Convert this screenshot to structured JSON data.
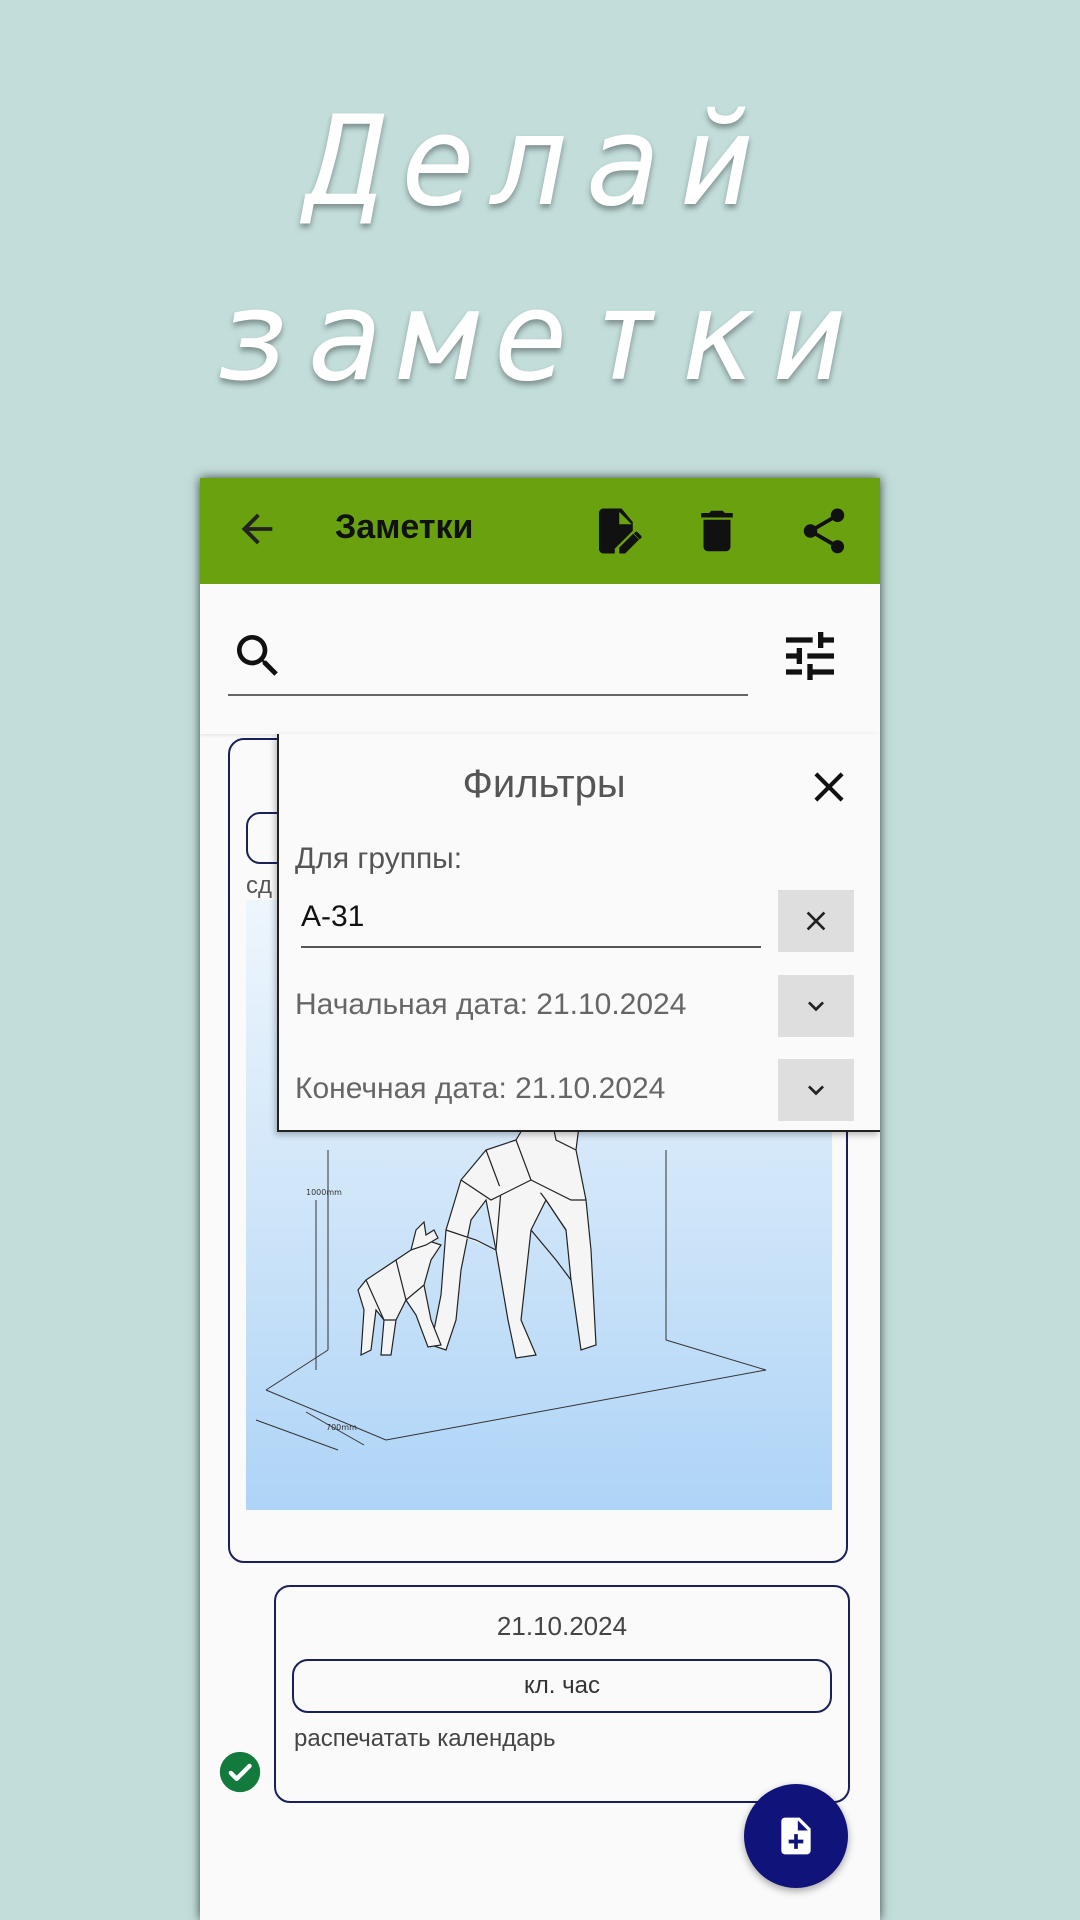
{
  "promo": {
    "line1": "Делай",
    "line2": "заметки"
  },
  "appbar": {
    "title": "Заметки",
    "background_color": "#6aa10e"
  },
  "search": {
    "value": "",
    "placeholder": ""
  },
  "filters": {
    "title": "Фильтры",
    "group_label": "Для группы:",
    "group_value": "А-31",
    "start_date_text": "Начальная дата: 21.10.2024",
    "end_date_text": "Конечная дата: 21.10.2024"
  },
  "notes": [
    {
      "date": "",
      "tag": "",
      "body_partial": "сд",
      "has_image": true
    },
    {
      "date": "21.10.2024",
      "tag": "кл. час",
      "body": "распечатать календарь",
      "completed": true
    }
  ],
  "image": {
    "dimension_label_height": "1000mm",
    "dimension_label_width": "700mm"
  },
  "icons": {
    "back": "arrow-back-icon",
    "edit": "edit-document-icon",
    "delete": "trash-icon",
    "share": "share-icon",
    "search": "search-icon",
    "filter": "tune-icon",
    "close": "close-icon",
    "clear": "clear-icon",
    "dropdown": "chevron-down-icon",
    "check": "check-circle-icon",
    "add_note": "note-add-icon"
  },
  "colors": {
    "page_background": "#c2ddda",
    "appbar": "#6aa10e",
    "accent": "#10137a",
    "check": "#137a3e"
  }
}
